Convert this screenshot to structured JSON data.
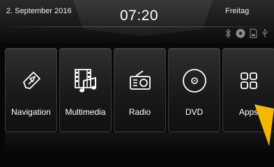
{
  "header": {
    "date": "2. September 2016",
    "time": "07:20",
    "weekday": "Freitag"
  },
  "status_icons": [
    "bluetooth-icon",
    "media-disc-icon",
    "sd-card-icon",
    "usb-icon"
  ],
  "apps": [
    {
      "label": "Navigation",
      "icon": "navigation-arrow-icon"
    },
    {
      "label": "Multimedia",
      "icon": "film-music-icon"
    },
    {
      "label": "Radio",
      "icon": "radio-icon"
    },
    {
      "label": "DVD",
      "icon": "disc-icon"
    },
    {
      "label": "Apps",
      "icon": "app-grid-icon"
    }
  ],
  "colors": {
    "accent_arrow": "#f5b800",
    "background": "#070707",
    "tile": "#222222"
  }
}
